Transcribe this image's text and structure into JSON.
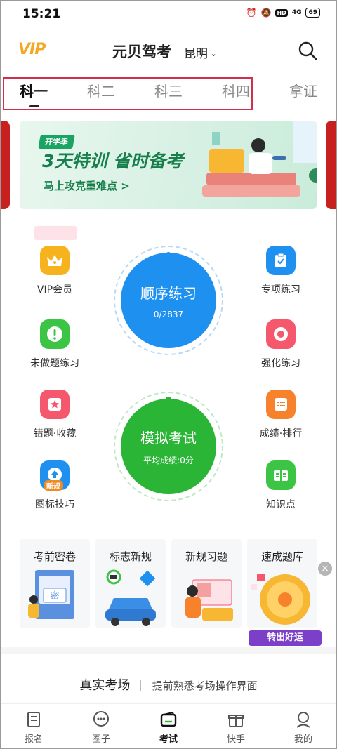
{
  "status_bar": {
    "time": "15:21",
    "network": "4G",
    "battery": "69",
    "hd": "HD"
  },
  "header": {
    "logo": "VIP",
    "title": "元贝驾考",
    "city": "昆明"
  },
  "tabs": [
    {
      "label": "科一",
      "active": true
    },
    {
      "label": "科二",
      "active": false
    },
    {
      "label": "科三",
      "active": false
    },
    {
      "label": "科四",
      "active": false
    },
    {
      "label": "拿证",
      "active": false
    }
  ],
  "banner": {
    "tag": "开学季",
    "headline": "3天特训 省时备考",
    "subline": "马上攻克重难点 >"
  },
  "features": {
    "vip": "VIP会员",
    "special": "专项练习",
    "undone": "未做题练习",
    "strengthen": "强化练习",
    "wrong_fav": "错题·收藏",
    "score_rank": "成绩·排行",
    "icon_skill": "图标技巧",
    "icon_skill_tag": "新规",
    "knowledge": "知识点"
  },
  "practice": {
    "title": "顺序练习",
    "progress": "0/2837",
    "color": "#1e90f0"
  },
  "mock": {
    "title": "模拟考试",
    "avg": "平均成绩:0分",
    "color": "#2bb536"
  },
  "cards": [
    "考前密卷",
    "标志新规",
    "新规习题",
    "速成题库"
  ],
  "card_extras": {
    "secret": "密",
    "luck": "转出好运"
  },
  "exam_section": {
    "title": "真实考场",
    "subtitle": "提前熟悉考场操作界面"
  },
  "bottom_nav": [
    {
      "label": "报名",
      "active": false
    },
    {
      "label": "圈子",
      "active": false
    },
    {
      "label": "考试",
      "active": true
    },
    {
      "label": "快手",
      "active": false
    },
    {
      "label": "我的",
      "active": false
    }
  ]
}
